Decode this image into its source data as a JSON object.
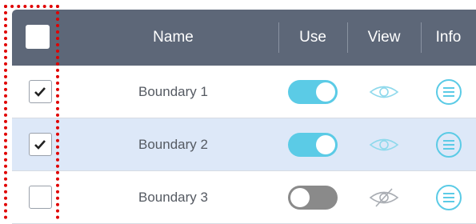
{
  "header": {
    "name_label": "Name",
    "use_label": "Use",
    "view_label": "View",
    "info_label": "Info"
  },
  "rows": [
    {
      "name": "Boundary 1",
      "checked": true,
      "use": "on",
      "view": "visible"
    },
    {
      "name": "Boundary 2",
      "checked": true,
      "use": "on",
      "view": "visible"
    },
    {
      "name": "Boundary 3",
      "checked": false,
      "use": "off",
      "view": "hidden"
    }
  ],
  "colors": {
    "header_bg": "#5d6778",
    "accent": "#5bcbe6",
    "selected_row": "#dde8f8",
    "highlight_border": "#e00000"
  },
  "icons": {
    "check": "check-icon",
    "view_visible": "eye-icon",
    "view_hidden": "eye-off-icon",
    "info": "menu-lines-icon"
  }
}
